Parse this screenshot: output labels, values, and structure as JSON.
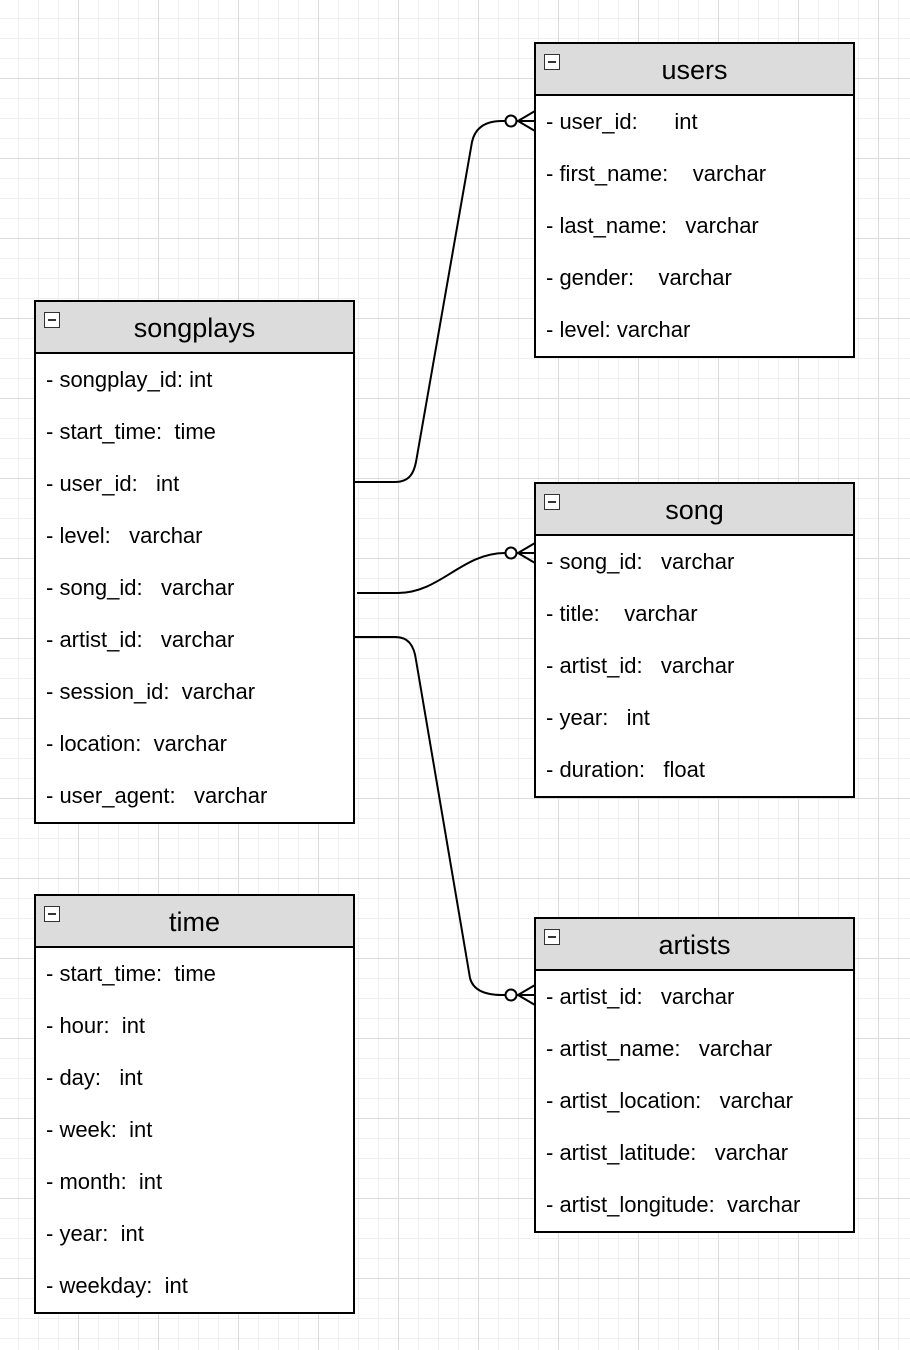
{
  "entities": {
    "users": {
      "name": "users",
      "fields": [
        "- user_id:      int",
        "- first_name:    varchar",
        "- last_name:   varchar",
        "- gender:    varchar",
        "- level: varchar"
      ]
    },
    "songplays": {
      "name": "songplays",
      "fields": [
        "- songplay_id: int",
        "- start_time:  time",
        "- user_id:   int",
        "- level:   varchar",
        "- song_id:   varchar",
        "- artist_id:   varchar",
        "- session_id:  varchar",
        "- location:  varchar",
        "- user_agent:   varchar"
      ]
    },
    "song": {
      "name": "song",
      "fields": [
        "- song_id:   varchar",
        "- title:    varchar",
        "- artist_id:   varchar",
        "- year:   int",
        "- duration:   float"
      ]
    },
    "time": {
      "name": "time",
      "fields": [
        "- start_time:  time",
        "- hour:  int",
        "- day:   int",
        "- week:  int",
        "- month:  int",
        "- year:  int",
        "- weekday:  int"
      ]
    },
    "artists": {
      "name": "artists",
      "fields": [
        "- artist_id:   varchar",
        "- artist_name:   varchar",
        "- artist_location:   varchar",
        "- artist_latitude:   varchar",
        "- artist_longitude:  varchar"
      ]
    }
  },
  "relationships": [
    {
      "from": "songplays.user_id",
      "to": "users.user_id",
      "notation": "zero-or-many"
    },
    {
      "from": "songplays.song_id",
      "to": "song.song_id",
      "notation": "zero-or-many"
    },
    {
      "from": "songplays.artist_id",
      "to": "artists.artist_id",
      "notation": "zero-or-many"
    }
  ]
}
